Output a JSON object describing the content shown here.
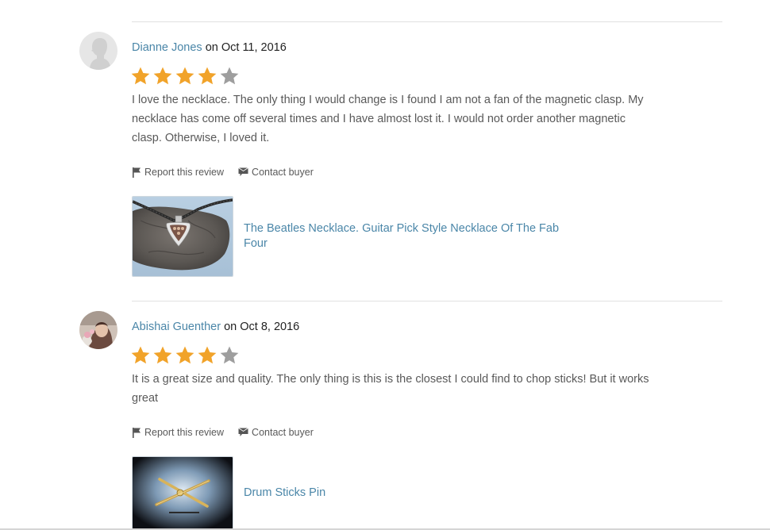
{
  "reviews": [
    {
      "author": "Dianne Jones",
      "date_prefix": " on ",
      "date": "Oct 11, 2016",
      "rating": 4,
      "rating_max": 5,
      "text": "I love the necklace. The only thing I would change is I found I am not a fan of the magnetic clasp. My necklace has come off several times and I have almost lost it. I would not order another magnetic clasp. Otherwise, I loved it.",
      "report_label": "Report this review",
      "contact_label": "Contact buyer",
      "listing_title": "The Beatles Necklace. Guitar Pick Style Necklace Of The Fab Four"
    },
    {
      "author": "Abishai Guenther",
      "date_prefix": " on ",
      "date": "Oct 8, 2016",
      "rating": 4,
      "rating_max": 5,
      "text": "It is a great size and quality. The only thing is this is the closest I could find to chop sticks! But it works great",
      "report_label": "Report this review",
      "contact_label": "Contact buyer",
      "listing_title": "Drum Sticks Pin"
    }
  ],
  "colors": {
    "link": "#4a86a8",
    "star_filled": "#f1a32a",
    "star_empty": "#9e9e9e",
    "text": "#595959"
  },
  "icons": {
    "report": "flag-icon",
    "contact": "speech-bubble-icon",
    "star": "star-icon",
    "default_avatar": "user-silhouette-icon"
  }
}
